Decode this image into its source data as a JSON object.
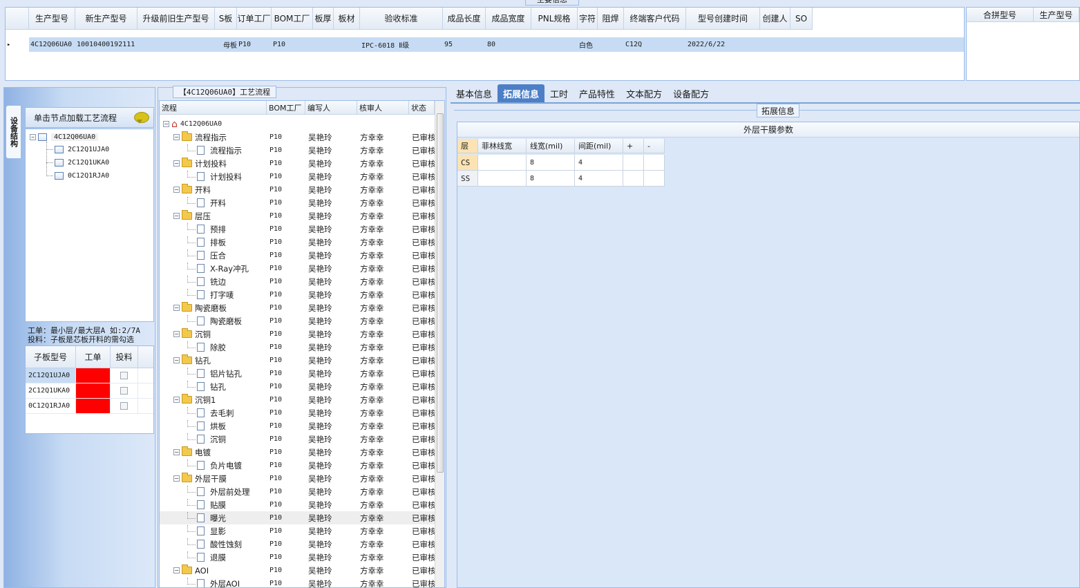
{
  "top_panel_tab": "主要信息",
  "main_grid": {
    "columns": [
      "生产型号",
      "新生产型号",
      "升级前旧生产型号",
      "S板",
      "订单工厂",
      "BOM工厂",
      "板厚",
      "板材",
      "验收标准",
      "成品长度",
      "成品宽度",
      "PNL规格",
      "字符",
      "阻焊",
      "终端客户代码",
      "型号创建时间",
      "创建人",
      "SO"
    ],
    "row": [
      "4C12Q06UA0",
      "10010400192111",
      "",
      "母板",
      "P10",
      "P10",
      "",
      "",
      "IPC-6018 Ⅱ级",
      "95",
      "80",
      "",
      "白色",
      "",
      "C12Q",
      "2022/6/22",
      "",
      ""
    ]
  },
  "merge_grid": {
    "columns": [
      "合拼型号",
      "生产型号"
    ]
  },
  "left_panel": {
    "vertical_tab": "设备结构",
    "header": "单击节点加载工艺流程",
    "tree_root": "4C12Q06UA0",
    "tree_children": [
      "2C12Q1UJA0",
      "2C12Q1UKA0",
      "0C12Q1RJA0"
    ],
    "note_line1": "工单：最小层/最大层A 如:2/7A",
    "note_line2": "投料：子板是芯板开料的需勾选",
    "sub_grid_columns": [
      "子板型号",
      "工单",
      "投料"
    ],
    "sub_grid_rows": [
      {
        "model": "2C12Q1UJA0",
        "order_color": "#ff0000",
        "checked": false
      },
      {
        "model": "2C12Q1UKA0",
        "order_color": "#ff0000",
        "checked": false
      },
      {
        "model": "0C12Q1RJA0",
        "order_color": "#ff0000",
        "checked": false
      }
    ]
  },
  "process": {
    "title": "【4C12Q06UA0】工艺流程",
    "columns": [
      "流程",
      "BOM工厂",
      "编写人",
      "核审人",
      "状态"
    ],
    "root": "4C12Q06UA0",
    "rows": [
      {
        "name": "流程指示",
        "type": "folder",
        "bom": "P10",
        "writer": "吴艳玲",
        "reviewer": "方幸幸",
        "status": "已审核"
      },
      {
        "name": "流程指示",
        "type": "item",
        "bom": "P10",
        "writer": "吴艳玲",
        "reviewer": "方幸幸",
        "status": "已审核"
      },
      {
        "name": "计划投料",
        "type": "folder",
        "bom": "P10",
        "writer": "吴艳玲",
        "reviewer": "方幸幸",
        "status": "已审核"
      },
      {
        "name": "计划投料",
        "type": "item",
        "bom": "P10",
        "writer": "吴艳玲",
        "reviewer": "方幸幸",
        "status": "已审核"
      },
      {
        "name": "开料",
        "type": "folder",
        "bom": "P10",
        "writer": "吴艳玲",
        "reviewer": "方幸幸",
        "status": "已审核"
      },
      {
        "name": "开料",
        "type": "item",
        "bom": "P10",
        "writer": "吴艳玲",
        "reviewer": "方幸幸",
        "status": "已审核"
      },
      {
        "name": "层压",
        "type": "folder",
        "bom": "P10",
        "writer": "吴艳玲",
        "reviewer": "方幸幸",
        "status": "已审核"
      },
      {
        "name": "预排",
        "type": "item",
        "bom": "P10",
        "writer": "吴艳玲",
        "reviewer": "方幸幸",
        "status": "已审核"
      },
      {
        "name": "排板",
        "type": "item",
        "bom": "P10",
        "writer": "吴艳玲",
        "reviewer": "方幸幸",
        "status": "已审核"
      },
      {
        "name": "压合",
        "type": "item",
        "bom": "P10",
        "writer": "吴艳玲",
        "reviewer": "方幸幸",
        "status": "已审核"
      },
      {
        "name": "X-Ray冲孔",
        "type": "item",
        "bom": "P10",
        "writer": "吴艳玲",
        "reviewer": "方幸幸",
        "status": "已审核"
      },
      {
        "name": "铣边",
        "type": "item",
        "bom": "P10",
        "writer": "吴艳玲",
        "reviewer": "方幸幸",
        "status": "已审核"
      },
      {
        "name": "打字唛",
        "type": "item",
        "bom": "P10",
        "writer": "吴艳玲",
        "reviewer": "方幸幸",
        "status": "已审核"
      },
      {
        "name": "陶瓷磨板",
        "type": "folder",
        "bom": "P10",
        "writer": "吴艳玲",
        "reviewer": "方幸幸",
        "status": "已审核"
      },
      {
        "name": "陶瓷磨板",
        "type": "item",
        "bom": "P10",
        "writer": "吴艳玲",
        "reviewer": "方幸幸",
        "status": "已审核"
      },
      {
        "name": "沉铜",
        "type": "folder",
        "bom": "P10",
        "writer": "吴艳玲",
        "reviewer": "方幸幸",
        "status": "已审核"
      },
      {
        "name": "除胶",
        "type": "item",
        "bom": "P10",
        "writer": "吴艳玲",
        "reviewer": "方幸幸",
        "status": "已审核"
      },
      {
        "name": "钻孔",
        "type": "folder",
        "bom": "P10",
        "writer": "吴艳玲",
        "reviewer": "方幸幸",
        "status": "已审核"
      },
      {
        "name": "铝片钻孔",
        "type": "item",
        "bom": "P10",
        "writer": "吴艳玲",
        "reviewer": "方幸幸",
        "status": "已审核"
      },
      {
        "name": "钻孔",
        "type": "item",
        "bom": "P10",
        "writer": "吴艳玲",
        "reviewer": "方幸幸",
        "status": "已审核"
      },
      {
        "name": "沉铜1",
        "type": "folder",
        "bom": "P10",
        "writer": "吴艳玲",
        "reviewer": "方幸幸",
        "status": "已审核"
      },
      {
        "name": "去毛刺",
        "type": "item",
        "bom": "P10",
        "writer": "吴艳玲",
        "reviewer": "方幸幸",
        "status": "已审核"
      },
      {
        "name": "烘板",
        "type": "item",
        "bom": "P10",
        "writer": "吴艳玲",
        "reviewer": "方幸幸",
        "status": "已审核"
      },
      {
        "name": "沉铜",
        "type": "item",
        "bom": "P10",
        "writer": "吴艳玲",
        "reviewer": "方幸幸",
        "status": "已审核"
      },
      {
        "name": "电镀",
        "type": "folder",
        "bom": "P10",
        "writer": "吴艳玲",
        "reviewer": "方幸幸",
        "status": "已审核"
      },
      {
        "name": "负片电镀",
        "type": "item",
        "bom": "P10",
        "writer": "吴艳玲",
        "reviewer": "方幸幸",
        "status": "已审核"
      },
      {
        "name": "外层干膜",
        "type": "folder",
        "bom": "P10",
        "writer": "吴艳玲",
        "reviewer": "方幸幸",
        "status": "已审核"
      },
      {
        "name": "外层前处理",
        "type": "item",
        "bom": "P10",
        "writer": "吴艳玲",
        "reviewer": "方幸幸",
        "status": "已审核"
      },
      {
        "name": "贴膜",
        "type": "item",
        "bom": "P10",
        "writer": "吴艳玲",
        "reviewer": "方幸幸",
        "status": "已审核"
      },
      {
        "name": "曝光",
        "type": "item",
        "bom": "P10",
        "writer": "吴艳玲",
        "reviewer": "方幸幸",
        "status": "已审核",
        "selected": true
      },
      {
        "name": "显影",
        "type": "item",
        "bom": "P10",
        "writer": "吴艳玲",
        "reviewer": "方幸幸",
        "status": "已审核"
      },
      {
        "name": "酸性蚀刻",
        "type": "item",
        "bom": "P10",
        "writer": "吴艳玲",
        "reviewer": "方幸幸",
        "status": "已审核"
      },
      {
        "name": "退膜",
        "type": "item",
        "bom": "P10",
        "writer": "吴艳玲",
        "reviewer": "方幸幸",
        "status": "已审核"
      },
      {
        "name": "AOI",
        "type": "folder",
        "bom": "P10",
        "writer": "吴艳玲",
        "reviewer": "方幸幸",
        "status": "已审核"
      },
      {
        "name": "外层AOI",
        "type": "item",
        "bom": "P10",
        "writer": "吴艳玲",
        "reviewer": "方幸幸",
        "status": "已审核"
      }
    ]
  },
  "right_tabs": [
    "基本信息",
    "拓展信息",
    "工时",
    "产品特性",
    "文本配方",
    "设备配方"
  ],
  "active_tab": "拓展信息",
  "extension": {
    "fieldset_title": "拓展信息",
    "grid_title": "外层干膜参数",
    "columns": [
      "层",
      "菲林线宽",
      "线宽(mil)",
      "间距(mil)",
      "+",
      "-"
    ],
    "rows": [
      {
        "layer": "CS",
        "film": "",
        "width": "8",
        "spacing": "4"
      },
      {
        "layer": "SS",
        "film": "",
        "width": "8",
        "spacing": "4"
      }
    ]
  }
}
